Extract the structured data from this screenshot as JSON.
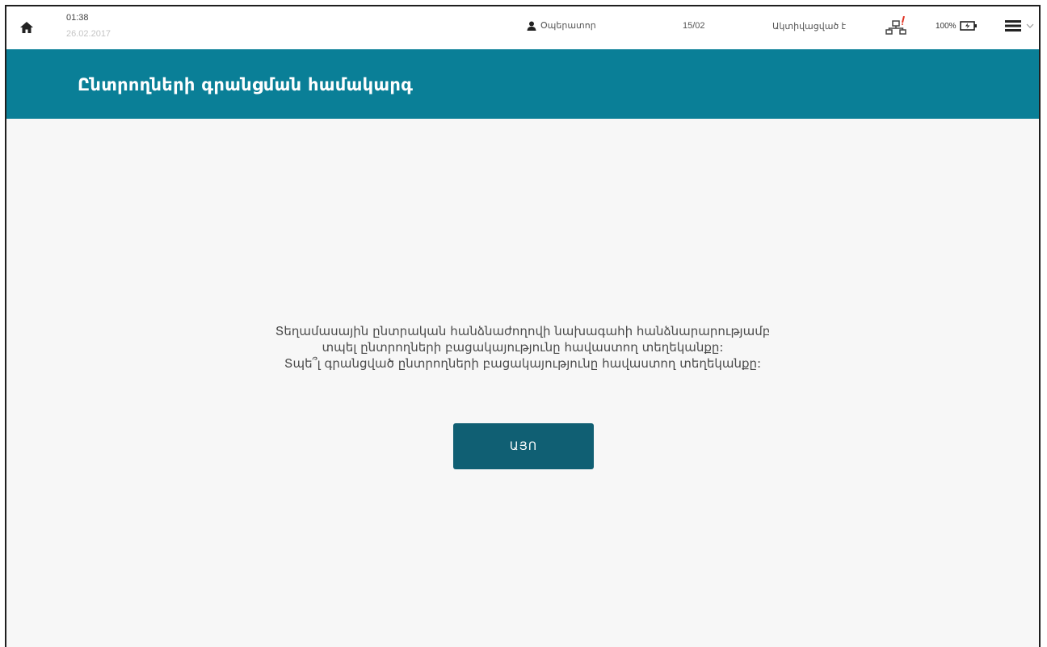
{
  "topbar": {
    "time": "01:38",
    "date": "26.02.2017",
    "user_label": "Օպերատոր",
    "counter": "15/02",
    "status": "Ակտիվացված է",
    "battery": "100%"
  },
  "header": {
    "title": "Ընտրողների գրանցման համակարգ"
  },
  "message": {
    "line1": "Տեղամասային ընտրական հանձնաժողովի նախագահի հանձնարարությամբ",
    "line2": "տպել ընտրողների բացակայությունը հավաստող տեղեկանքը:",
    "line3": "Տպե՞լ գրանցված ընտրողների բացակայությունը հավաստող տեղեկանքը:"
  },
  "actions": {
    "yes_label": "ԱՅՈ"
  },
  "colors": {
    "header_bg": "#0a7f97",
    "button_bg": "#105f73"
  },
  "icons": [
    "home-icon",
    "user-icon",
    "network-icon",
    "battery-icon",
    "menu-icon",
    "chevron-down-icon"
  ]
}
